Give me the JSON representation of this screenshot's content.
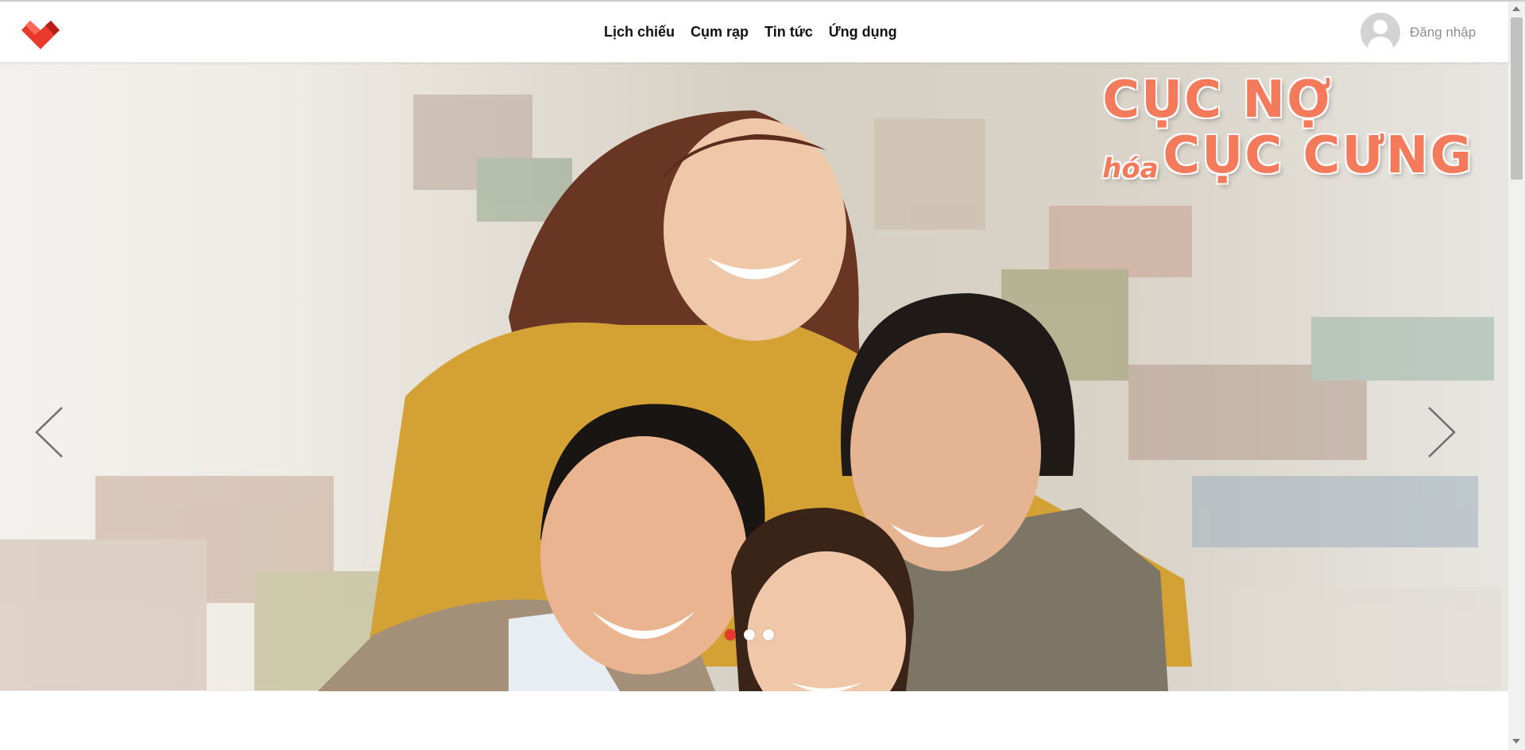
{
  "header": {
    "logo_icon": "heart-logo-icon",
    "nav": [
      {
        "label": "Lịch chiếu"
      },
      {
        "label": "Cụm rạp"
      },
      {
        "label": "Tin tức"
      },
      {
        "label": "Ứng dụng"
      }
    ],
    "login_label": "Đăng nhập",
    "avatar_icon": "user-avatar-icon"
  },
  "carousel": {
    "poster_title_line1": "CỤC NỢ",
    "poster_title_small": "hóa",
    "poster_title_line2": "CỤC CƯNG",
    "prev_icon": "chevron-left-icon",
    "next_icon": "chevron-right-icon",
    "slide_count": 3,
    "active_slide": 1
  },
  "colors": {
    "brand": "#e8392d",
    "title": "#f47a5c",
    "nav_text": "#111111",
    "login_text": "#8f8f8f"
  }
}
